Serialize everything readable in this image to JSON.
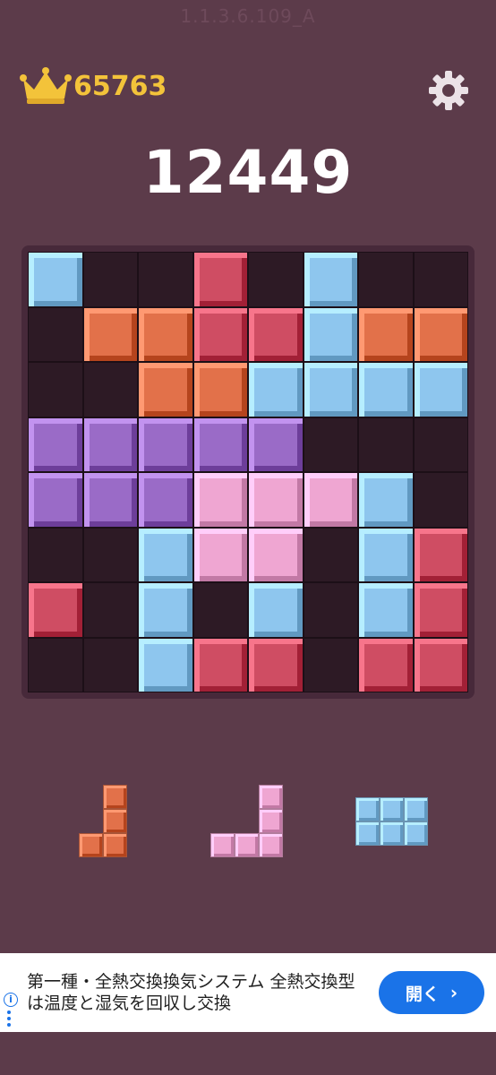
{
  "header": {
    "version": "1.1.3.6.109_A",
    "best_score": "65763",
    "current_score": "12449",
    "icons": {
      "crown": "crown-icon",
      "settings": "gear-icon"
    }
  },
  "colors": {
    "blue": "#8ec6ee",
    "red": "#cf4d63",
    "orange": "#e2714a",
    "purple": "#9a6bc7",
    "pink": "#efa6d2",
    "empty": "#2d1a25",
    "background": "#5c3b4a",
    "accent_gold": "#f3c33a"
  },
  "board": {
    "size": 8,
    "rows": [
      [
        "blue",
        "",
        "",
        "red",
        "",
        "blue",
        "",
        ""
      ],
      [
        "",
        "orange",
        "orange",
        "red",
        "red",
        "blue",
        "orange",
        "orange"
      ],
      [
        "",
        "",
        "orange",
        "orange",
        "blue",
        "blue",
        "blue",
        "blue"
      ],
      [
        "purple",
        "purple",
        "purple",
        "purple",
        "purple",
        "",
        "",
        ""
      ],
      [
        "purple",
        "purple",
        "purple",
        "pink",
        "pink",
        "pink",
        "blue",
        ""
      ],
      [
        "",
        "",
        "blue",
        "pink",
        "pink",
        "",
        "blue",
        "red"
      ],
      [
        "red",
        "",
        "blue",
        "",
        "blue",
        "",
        "blue",
        "red"
      ],
      [
        "",
        "",
        "blue",
        "red",
        "red",
        "",
        "red",
        "red"
      ]
    ]
  },
  "pieces": [
    {
      "color": "orange",
      "cells": [
        [
          0,
          1
        ],
        [
          1,
          1
        ],
        [
          2,
          0
        ],
        [
          2,
          1
        ]
      ]
    },
    {
      "color": "pink",
      "cells": [
        [
          0,
          2
        ],
        [
          1,
          2
        ],
        [
          2,
          0
        ],
        [
          2,
          1
        ],
        [
          2,
          2
        ]
      ]
    },
    {
      "color": "blue",
      "cells": [
        [
          0,
          0
        ],
        [
          0,
          1
        ],
        [
          0,
          2
        ],
        [
          1,
          0
        ],
        [
          1,
          1
        ],
        [
          1,
          2
        ]
      ]
    }
  ],
  "ad": {
    "text": "第一種・全熱交換換気システム 全熱交換型は温度と湿気を回収し交換",
    "button_label": "開く",
    "button_chevron": "›",
    "info_symbol": "i"
  }
}
